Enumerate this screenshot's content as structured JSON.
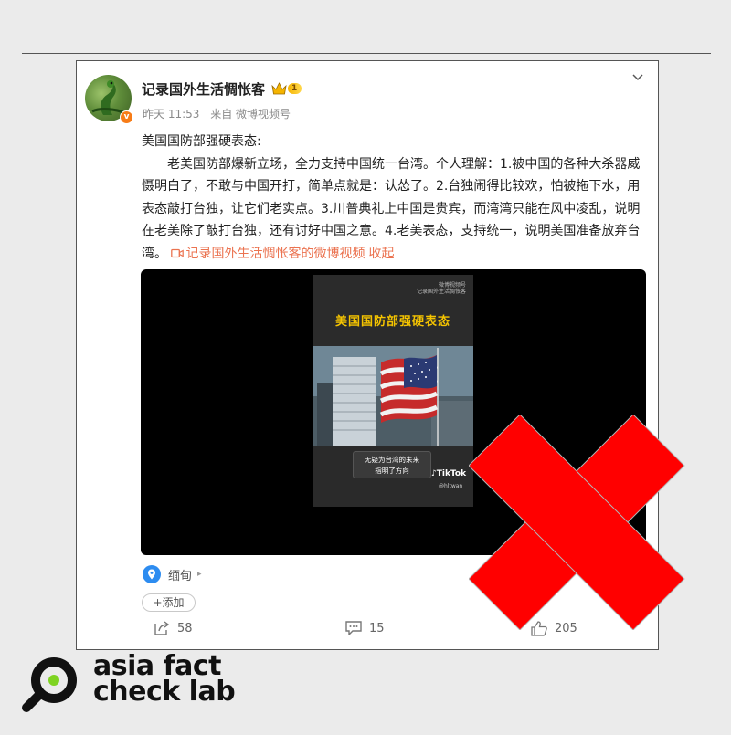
{
  "post": {
    "username": "记录国外生活惆怅客",
    "vip_level": "1",
    "verified_badge": "v",
    "time": "昨天 11:53",
    "source": "来自 微博视频号",
    "title": "美国国防部强硬表态:",
    "content": "老美国防部爆新立场，全力支持中国统一台湾。个人理解：1.被中国的各种大杀器威慑明白了，不敢与中国开打，简单点就是：认怂了。2.台独闹得比较欢，怕被拖下水，用表态敲打台独，让它们老实点。3.川普典礼上中国是贵宾，而湾湾只能在风中凌乱，说明在老美除了敲打台独，还有讨好中国之意。4.老美表态，支持统一，说明美国准备放弃台湾。",
    "video_link": "记录国外生活惆怅客的微博视频",
    "collapse_label": "收起"
  },
  "video": {
    "frame_logo_line1": "微博视频号",
    "frame_logo_line2": "记录国外生活惆怅客",
    "frame_title": "美国国防部强硬表态",
    "frame_caption_line1": "无疑为台湾的未来",
    "frame_caption_line2": "指明了方向",
    "tiktok": "TikTok",
    "tiktok_handle": "@hltwan"
  },
  "location": {
    "label": "缅甸"
  },
  "add_label": "+添加",
  "actions": {
    "share_count": "58",
    "comment_count": "15",
    "like_count": "205"
  },
  "overlay": {
    "icon": "red-x-icon",
    "color": "#ff0000"
  },
  "brand": {
    "line1": "asia fact",
    "line2": "check lab"
  },
  "colors": {
    "accent": "#eb7350",
    "link_blue": "#2d8cf0",
    "background": "#ebebeb"
  }
}
